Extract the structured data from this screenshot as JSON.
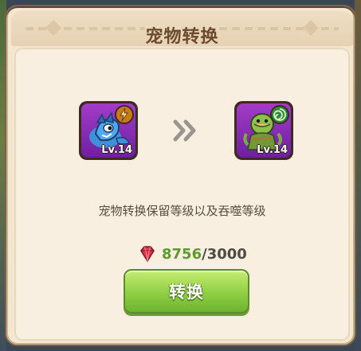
{
  "dialog": {
    "title": "宠物转换"
  },
  "pets": {
    "source": {
      "level_label": "Lv.14",
      "element_icon": "lightning-icon",
      "element_color": "#c97a1d"
    },
    "target": {
      "level_label": "Lv.14",
      "element_icon": "wind-icon",
      "element_color": "#2f8a3c"
    }
  },
  "arrow_icon": "double-chevron-right-icon",
  "description": "宠物转换保留等级以及吞噬等级",
  "cost": {
    "icon": "ruby-gem-icon",
    "current": "8756",
    "separator": "/",
    "required": "3000",
    "current_color": "#5d9a2f"
  },
  "button": {
    "label": "转换"
  },
  "colors": {
    "title": "#6b4a2f",
    "panel": "#f8efe0",
    "button_green": "#8fcf44"
  }
}
